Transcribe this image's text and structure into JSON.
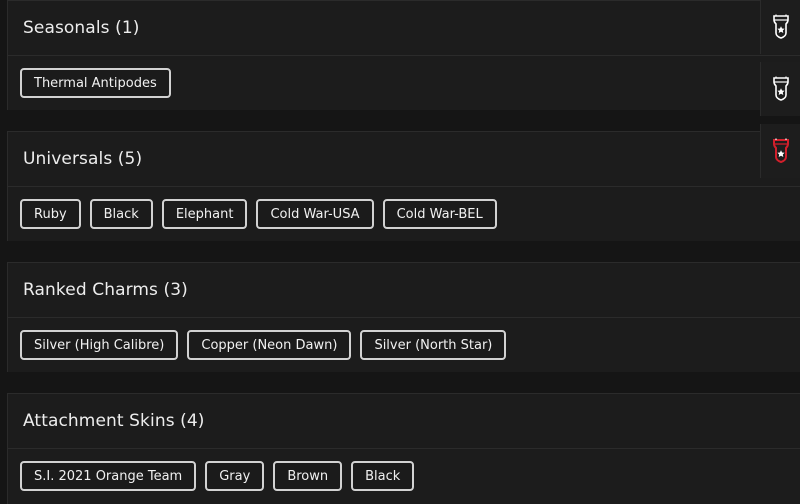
{
  "sections": [
    {
      "title": "Seasonals (1)",
      "chips": [
        "Thermal Antipodes"
      ]
    },
    {
      "title": "Universals (5)",
      "chips": [
        "Ruby",
        "Black",
        "Elephant",
        "Cold War-USA",
        "Cold War-BEL"
      ]
    },
    {
      "title": "Ranked Charms (3)",
      "chips": [
        "Silver (High Calibre)",
        "Copper (Neon Dawn)",
        "Silver (North Star)"
      ]
    },
    {
      "title": "Attachment Skins (4)",
      "chips": [
        "S.I. 2021 Orange Team",
        "Gray",
        "Brown",
        "Black"
      ]
    }
  ],
  "side_badges": [
    {
      "icon": "shield-star-badge-icon",
      "accent": "#ffffff"
    },
    {
      "icon": "shield-star-badge-icon",
      "accent": "#ffffff"
    },
    {
      "icon": "shield-star-badge-icon",
      "accent": "#d21f2b"
    }
  ]
}
